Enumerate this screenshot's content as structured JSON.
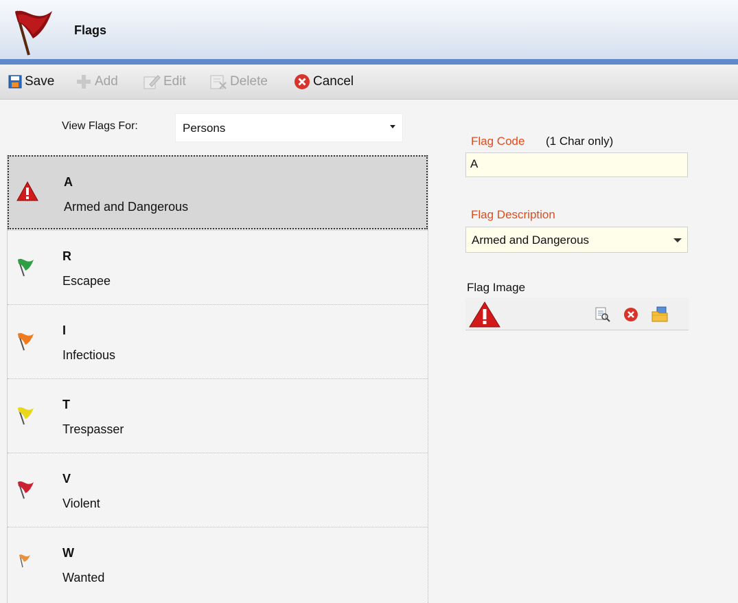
{
  "header": {
    "title": "Flags",
    "icon": "red-flag-icon"
  },
  "toolbar": {
    "save": "Save",
    "add": "Add",
    "edit": "Edit",
    "delete": "Delete",
    "cancel": "Cancel"
  },
  "view": {
    "label": "View Flags For:",
    "value": "Persons"
  },
  "flags": [
    {
      "code": "A",
      "description": "Armed and Dangerous",
      "icon": "warning-icon",
      "selected": true
    },
    {
      "code": "R",
      "description": "Escapee",
      "icon": "green-flag-icon",
      "color": "#2ea043"
    },
    {
      "code": "I",
      "description": "Infectious",
      "icon": "orange-flag-icon",
      "color": "#f07b1f"
    },
    {
      "code": "T",
      "description": "Trespasser",
      "icon": "yellow-flag-icon",
      "color": "#e8d81c"
    },
    {
      "code": "V",
      "description": "Violent",
      "icon": "red-flag-icon",
      "color": "#cc1f2f"
    },
    {
      "code": "W",
      "description": "Wanted",
      "icon": "small-orange-flag-icon",
      "color": "#e8923a"
    }
  ],
  "form": {
    "code_label": "Flag Code",
    "code_hint": "(1 Char only)",
    "code_value": "A",
    "description_label": "Flag Description",
    "description_value": "Armed and Dangerous",
    "image_label": "Flag Image"
  },
  "colors": {
    "accent_blue": "#5e8acb",
    "label_red": "#e64a19",
    "input_yellow": "#fffeeb",
    "selected_row": "#d7d7d7"
  }
}
